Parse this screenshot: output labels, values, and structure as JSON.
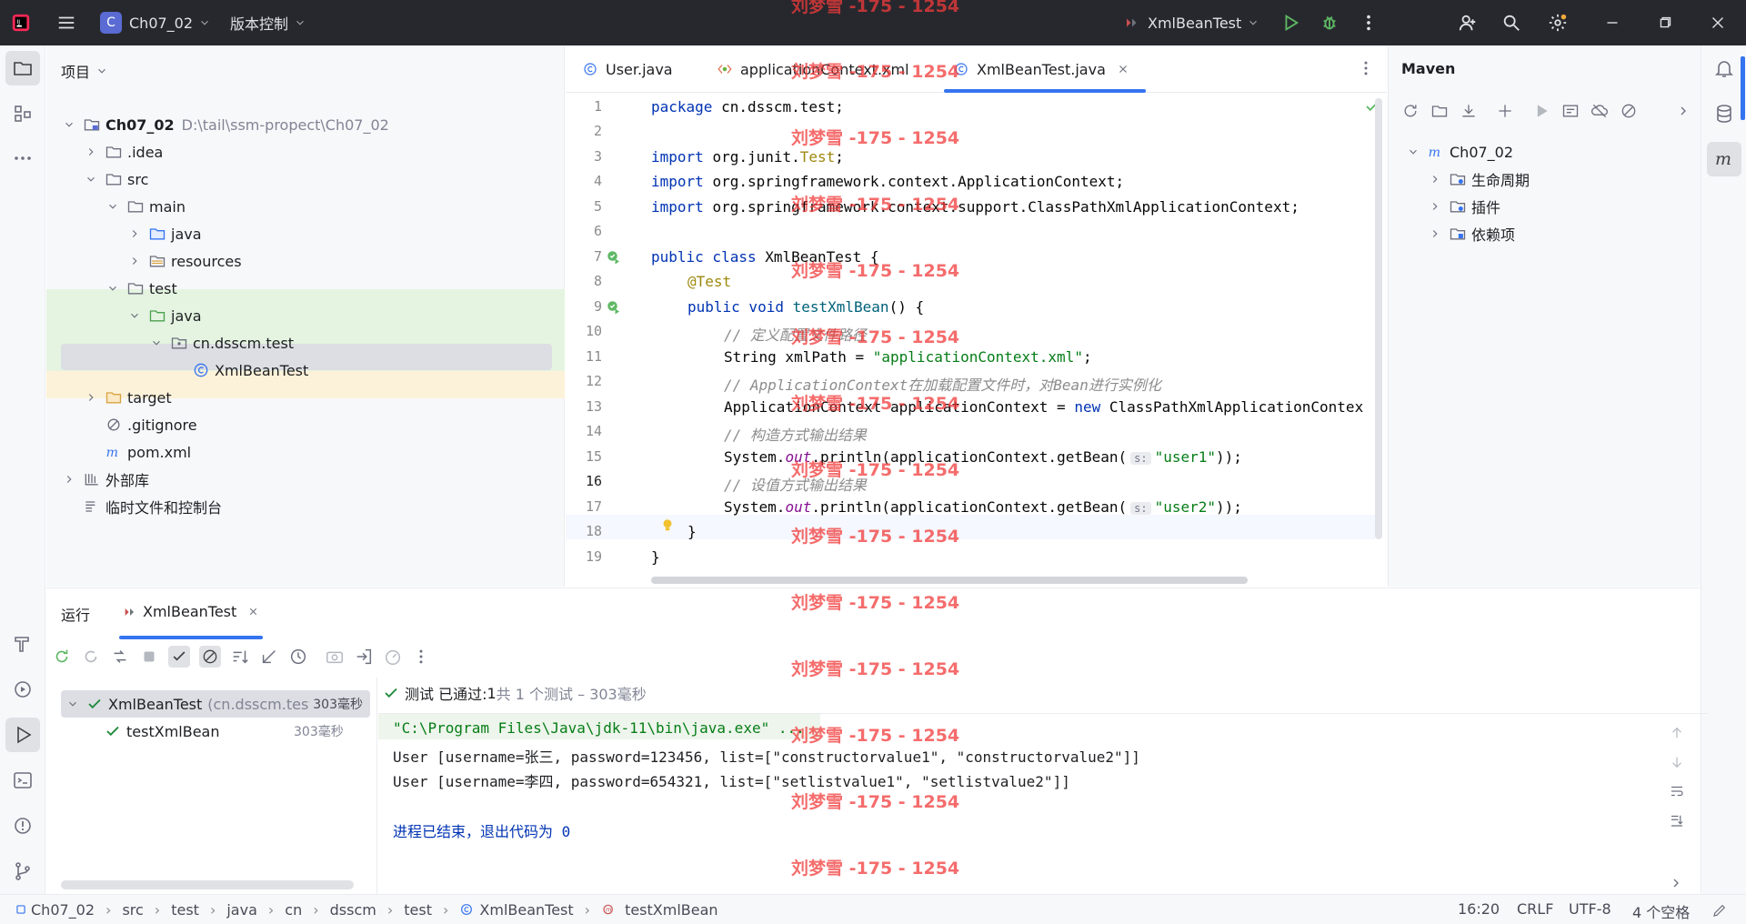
{
  "titlebar": {
    "project_badge": "C",
    "project_name": "Ch07_02",
    "vcs_label": "版本控制",
    "run_config": "XmlBeanTest"
  },
  "project_panel": {
    "title": "项目",
    "tree": [
      {
        "label": "Ch07_02",
        "sub": "D:\\tail\\ssm-propect\\Ch07_02",
        "icon": "module-folder-icon"
      },
      {
        "label": ".idea",
        "icon": "folder-icon"
      },
      {
        "label": "src",
        "icon": "folder-icon"
      },
      {
        "label": "main",
        "icon": "folder-icon"
      },
      {
        "label": "java",
        "icon": "source-folder-icon"
      },
      {
        "label": "resources",
        "icon": "resources-folder-icon"
      },
      {
        "label": "test",
        "icon": "folder-icon"
      },
      {
        "label": "java",
        "icon": "test-folder-icon"
      },
      {
        "label": "cn.dsscm.test",
        "icon": "package-icon"
      },
      {
        "label": "XmlBeanTest",
        "icon": "class-icon"
      },
      {
        "label": "target",
        "icon": "excluded-folder-icon"
      },
      {
        "label": ".gitignore",
        "icon": "ignore-file-icon"
      },
      {
        "label": "pom.xml",
        "icon": "maven-icon"
      },
      {
        "label": "外部库",
        "icon": "library-icon"
      },
      {
        "label": "临时文件和控制台",
        "icon": "scratch-icon"
      }
    ]
  },
  "editor": {
    "tabs": [
      {
        "label": "User.java",
        "icon": "class-icon"
      },
      {
        "label": "applicationContext.xml",
        "icon": "spring-xml-icon"
      },
      {
        "label": "XmlBeanTest.java",
        "icon": "class-icon"
      }
    ],
    "line_numbers": [
      "1",
      "2",
      "3",
      "4",
      "5",
      "6",
      "7",
      "8",
      "9",
      "10",
      "11",
      "12",
      "13",
      "14",
      "15",
      "16",
      "17",
      "18",
      "19"
    ],
    "code": {
      "l1a": "package ",
      "l1b": "cn.dsscm.test;",
      "l3a": "import ",
      "l3b": "org.junit.",
      "l3c": "Test",
      ";": ";",
      "l4a": "import ",
      "l4b": "org.springframework.context.ApplicationContext;",
      "l5a": "import ",
      "l5b": "org.springframework.context.support.ClassPathXmlApplicationContext;",
      "l7a": "public class ",
      "l7b": "XmlBeanTest {",
      "l8": "@Test",
      "l9a": "public void ",
      "l9b": "testXmlBean",
      "l9c": "() {",
      "l10": "// 定义配置文件路径",
      "l11a": "String xmlPath = ",
      "l11b": "\"applicationContext.xml\"",
      "l12": "// ApplicationContext在加载配置文件时，对Bean进行实例化",
      "l13a": "ApplicationContext applicationContext = ",
      "l13b": "new ",
      "l13c": "ClassPathXmlApplicationContex",
      "l14": "// 构造方式输出结果",
      "sys": "System.",
      "out": "out",
      "prn": ".println(applicationContext.getBean(",
      "hint": "s:",
      "l15s": "\"user1\"",
      "end": "));",
      "l16": "// 设值方式输出结果",
      "l17s": "\"user2\"",
      "l18": "}",
      "l19": "}"
    }
  },
  "maven": {
    "title": "Maven",
    "root": "Ch07_02",
    "items": [
      "生命周期",
      "插件",
      "依赖项"
    ]
  },
  "run": {
    "tab_label": "运行",
    "config_tab": "XmlBeanTest",
    "status_prefix": "测试 已通过: ",
    "status_count": "1",
    "status_rest": "共 1 个测试 – 303毫秒",
    "tests": [
      {
        "name": "XmlBeanTest",
        "pkg": "(cn.dsscm.test",
        "time": "303毫秒"
      },
      {
        "name": "testXmlBean",
        "time": "303毫秒"
      }
    ],
    "console": [
      "\"C:\\Program Files\\Java\\jdk-11\\bin\\java.exe\" ...",
      "User [username=张三, password=123456, list=[\"constructorvalue1\", \"constructorvalue2\"]]",
      "User [username=李四, password=654321, list=[\"setlistvalue1\", \"setlistvalue2\"]]",
      "",
      "进程已结束，退出代码为 0"
    ]
  },
  "statusbar": {
    "breadcrumbs": [
      "Ch07_02",
      "src",
      "test",
      "java",
      "cn",
      "dsscm",
      "test",
      "XmlBeanTest",
      "testXmlBean"
    ],
    "position": "16:20",
    "line_ending": "CRLF",
    "encoding": "UTF-8",
    "indent": "4 个空格"
  },
  "watermark": "刘梦雪 -175 - 1254",
  "colors": {
    "accent": "#3574f0",
    "pass": "#208a3c",
    "watermark": "#f23b3b"
  }
}
